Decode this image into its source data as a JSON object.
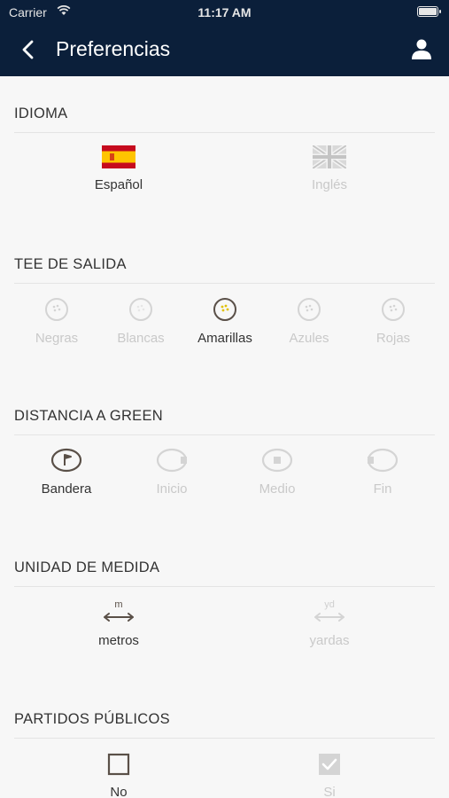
{
  "status_bar": {
    "carrier": "Carrier",
    "time": "11:17 AM"
  },
  "nav": {
    "title": "Preferencias"
  },
  "colors": {
    "header_bg": "#0b1f3a",
    "active": "#5a5048",
    "inactive": "#cccccc",
    "tee_yellow": "#e0c000"
  },
  "idioma": {
    "title": "IDIOMA",
    "options": [
      {
        "label": "Español",
        "icon": "spain-flag-icon",
        "selected": true
      },
      {
        "label": "Inglés",
        "icon": "uk-flag-icon",
        "selected": false
      }
    ]
  },
  "tee": {
    "title": "TEE DE SALIDA",
    "options": [
      {
        "label": "Negras",
        "icon": "golf-ball-icon",
        "selected": false
      },
      {
        "label": "Blancas",
        "icon": "golf-ball-icon",
        "selected": false
      },
      {
        "label": "Amarillas",
        "icon": "golf-ball-icon",
        "selected": true
      },
      {
        "label": "Azules",
        "icon": "golf-ball-icon",
        "selected": false
      },
      {
        "label": "Rojas",
        "icon": "golf-ball-icon",
        "selected": false
      }
    ]
  },
  "distancia": {
    "title": "DISTANCIA A GREEN",
    "options": [
      {
        "label": "Bandera",
        "icon": "flag-green-icon",
        "selected": true
      },
      {
        "label": "Inicio",
        "icon": "green-front-icon",
        "selected": false
      },
      {
        "label": "Medio",
        "icon": "green-middle-icon",
        "selected": false
      },
      {
        "label": "Fin",
        "icon": "green-back-icon",
        "selected": false
      }
    ]
  },
  "unidad": {
    "title": "UNIDAD DE MEDIDA",
    "options": [
      {
        "label": "metros",
        "unit": "m",
        "icon": "meters-icon",
        "selected": true
      },
      {
        "label": "yardas",
        "unit": "yd",
        "icon": "yards-icon",
        "selected": false
      }
    ]
  },
  "partidos": {
    "title": "PARTIDOS PÚBLICOS",
    "options": [
      {
        "label": "No",
        "icon": "checkbox-empty-icon",
        "selected": true
      },
      {
        "label": "Si",
        "icon": "checkbox-checked-icon",
        "selected": false
      }
    ]
  }
}
